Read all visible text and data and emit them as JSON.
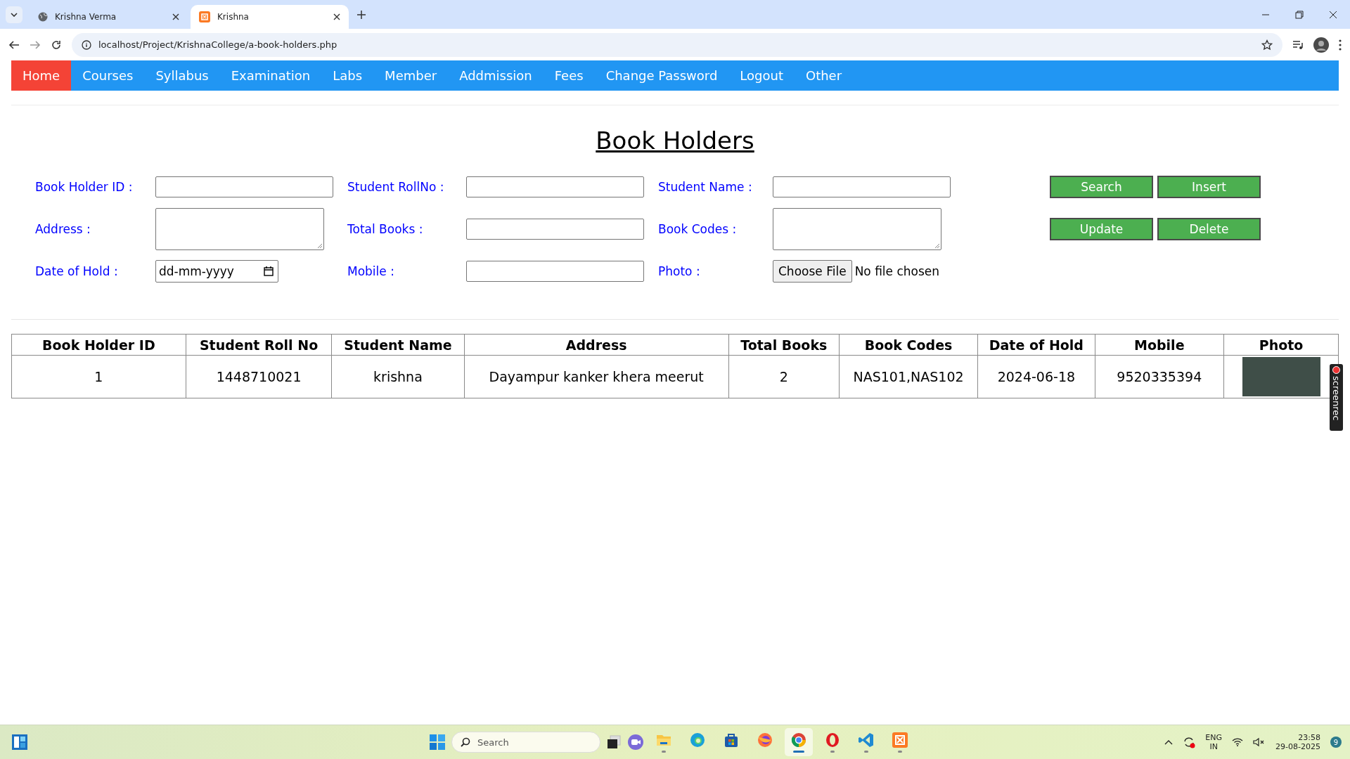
{
  "browser": {
    "tabs": [
      {
        "title": "Krishna Verma",
        "selected": false
      },
      {
        "title": "Krishna",
        "selected": true
      }
    ],
    "url": "localhost/Project/KrishnaCollege/a-book-holders.php"
  },
  "nav": {
    "items": [
      {
        "label": "Home",
        "selected": true
      },
      {
        "label": "Courses",
        "selected": false
      },
      {
        "label": "Syllabus",
        "selected": false
      },
      {
        "label": "Examination",
        "selected": false
      },
      {
        "label": "Labs",
        "selected": false
      },
      {
        "label": "Member",
        "selected": false
      },
      {
        "label": "Addmission",
        "selected": false
      },
      {
        "label": "Fees",
        "selected": false
      },
      {
        "label": "Change Password",
        "selected": false
      },
      {
        "label": "Logout",
        "selected": false
      },
      {
        "label": "Other",
        "selected": false
      }
    ]
  },
  "heading": "Book Holders",
  "form": {
    "fields": [
      {
        "label": "Book Holder ID :",
        "kind": "text"
      },
      {
        "label": "Student RollNo :",
        "kind": "text"
      },
      {
        "label": "Student Name :",
        "kind": "text"
      },
      {
        "label": "Address :",
        "kind": "textarea"
      },
      {
        "label": "Total Books :",
        "kind": "text"
      },
      {
        "label": "Book Codes :",
        "kind": "textarea"
      },
      {
        "label": "Date of Hold :",
        "kind": "date",
        "placeholder": "dd-mm-yyyy"
      },
      {
        "label": "Mobile :",
        "kind": "text"
      },
      {
        "label": "Photo :",
        "kind": "file",
        "button": "Choose File",
        "status": "No file chosen"
      }
    ],
    "buttons": [
      "Search",
      "Insert",
      "Update",
      "Delete"
    ]
  },
  "table": {
    "columns": [
      "Book Holder ID",
      "Student Roll No",
      "Student Name",
      "Address",
      "Total Books",
      "Book Codes",
      "Date of Hold",
      "Mobile",
      "Photo"
    ],
    "rows": [
      {
        "cells": [
          "1",
          "1448710021",
          "krishna",
          "Dayampur kanker khera meerut",
          "2",
          "NAS101,NAS102",
          "2024-06-18",
          "9520335394"
        ],
        "photo": true
      }
    ]
  },
  "overlay": {
    "label": "screenrec"
  },
  "taskbar": {
    "search_placeholder": "Search",
    "apps": [
      {
        "kind": "files",
        "running": true,
        "selected": false
      },
      {
        "kind": "edge",
        "running": false,
        "selected": false
      },
      {
        "kind": "store",
        "running": false,
        "selected": false
      },
      {
        "kind": "firefox",
        "running": false,
        "selected": false
      },
      {
        "kind": "chrome",
        "running": true,
        "selected": true
      },
      {
        "kind": "opera",
        "running": true,
        "selected": false
      },
      {
        "kind": "vscode",
        "running": true,
        "selected": false
      },
      {
        "kind": "xampp",
        "running": true,
        "selected": false
      }
    ],
    "language": "ENG",
    "region": "IN",
    "time": "23:58",
    "date": "29-08-2025",
    "notifications": "9"
  }
}
